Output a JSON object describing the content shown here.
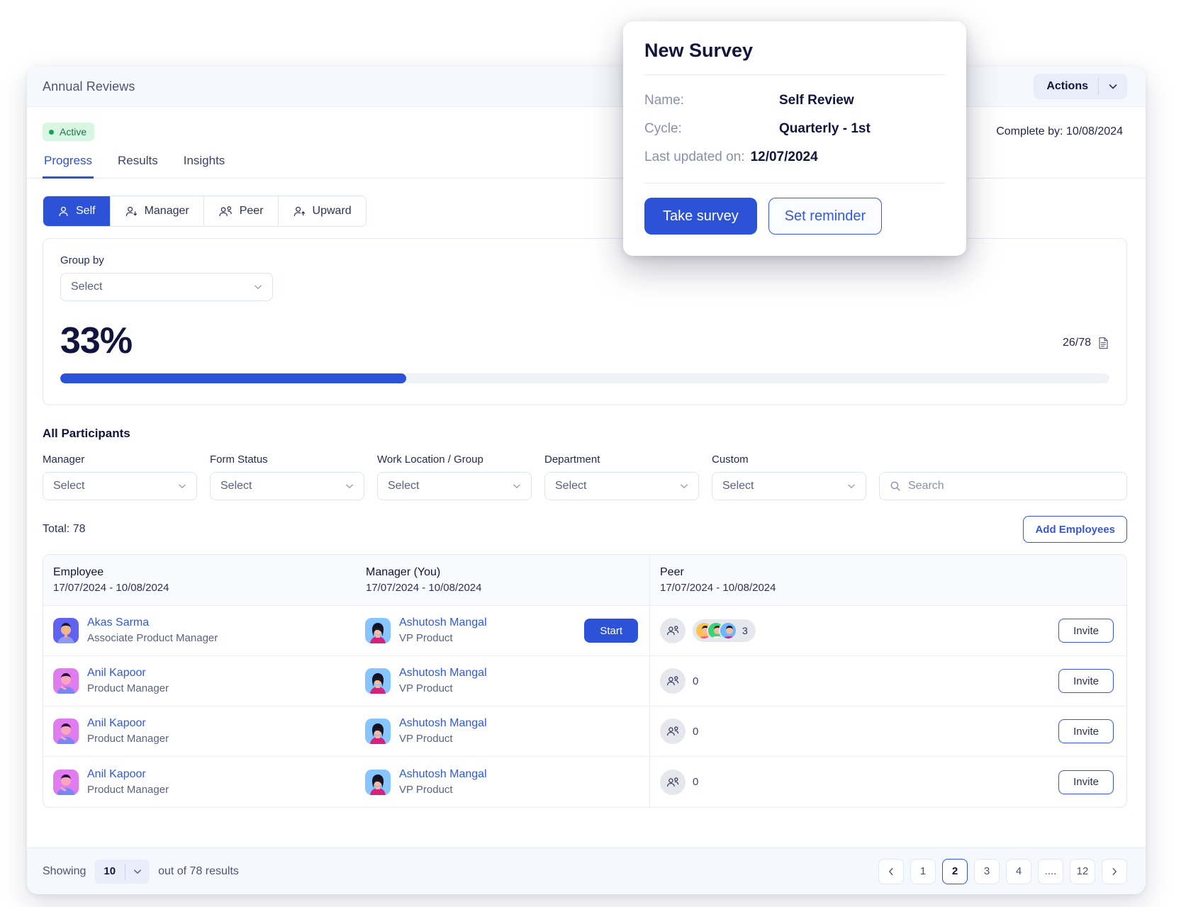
{
  "window": {
    "title": "Annual Reviews",
    "actions_label": "Actions",
    "status_badge": "Active",
    "complete_by": "Complete by: 10/08/2024"
  },
  "tabs": [
    {
      "label": "Progress",
      "active": true
    },
    {
      "label": "Results",
      "active": false
    },
    {
      "label": "Insights",
      "active": false
    }
  ],
  "segments": [
    {
      "label": "Self",
      "icon": "person-icon",
      "active": true
    },
    {
      "label": "Manager",
      "icon": "person-down-icon",
      "active": false
    },
    {
      "label": "Peer",
      "icon": "people-icon",
      "active": false
    },
    {
      "label": "Upward",
      "icon": "person-up-icon",
      "active": false
    }
  ],
  "progress": {
    "group_by_label": "Group by",
    "group_by_value": "Select",
    "percent_label": "33%",
    "percent_value": 33,
    "counter": "26/78",
    "counter_icon": "document-icon"
  },
  "participants": {
    "section_title": "All Participants",
    "total_label": "Total: 78",
    "add_employees_label": "Add Employees",
    "search_placeholder": "Search",
    "search_value": "",
    "filters": [
      {
        "label": "Manager",
        "value": "Select"
      },
      {
        "label": "Form Status",
        "value": "Select"
      },
      {
        "label": "Work Location / Group",
        "value": "Select"
      },
      {
        "label": "Department",
        "value": "Select"
      },
      {
        "label": "Custom",
        "value": "Select"
      }
    ]
  },
  "table": {
    "headers": [
      {
        "title": "Employee",
        "dates": "17/07/2024 - 10/08/2024"
      },
      {
        "title": "Manager (You)",
        "dates": "17/07/2024 - 10/08/2024"
      },
      {
        "title": "Peer",
        "dates": "17/07/2024 - 10/08/2024"
      }
    ],
    "rows": [
      {
        "employee_name": "Akas Sarma",
        "employee_role": "Associate Product Manager",
        "manager_name": "Ashutosh Mangal",
        "manager_role": "VP Product",
        "action_label": "Start",
        "has_action": true,
        "peer_count": "3",
        "peer_has_avatars": true,
        "invite_label": "Invite"
      },
      {
        "employee_name": "Anil Kapoor",
        "employee_role": "Product Manager",
        "manager_name": "Ashutosh Mangal",
        "manager_role": "VP Product",
        "action_label": "",
        "has_action": false,
        "peer_count": "0",
        "peer_has_avatars": false,
        "invite_label": "Invite"
      },
      {
        "employee_name": "Anil Kapoor",
        "employee_role": "Product Manager",
        "manager_name": "Ashutosh Mangal",
        "manager_role": "VP Product",
        "action_label": "",
        "has_action": false,
        "peer_count": "0",
        "peer_has_avatars": false,
        "invite_label": "Invite"
      },
      {
        "employee_name": "Anil Kapoor",
        "employee_role": "Product Manager",
        "manager_name": "Ashutosh Mangal",
        "manager_role": "VP Product",
        "action_label": "",
        "has_action": false,
        "peer_count": "0",
        "peer_has_avatars": false,
        "invite_label": "Invite"
      }
    ]
  },
  "footer": {
    "showing_label": "Showing",
    "page_size": "10",
    "out_of_label": "out of 78 results",
    "pages": [
      "1",
      "2",
      "3",
      "4",
      "....",
      "12"
    ],
    "active_page": "2",
    "prev_icon": "chevron-left-icon",
    "next_icon": "chevron-right-icon"
  },
  "popover": {
    "title": "New Survey",
    "rows": [
      {
        "key": "Name:",
        "value": "Self Review"
      },
      {
        "key": "Cycle:",
        "value": "Quarterly - 1st"
      },
      {
        "key": "Last updated on:",
        "value": "12/07/2024"
      }
    ],
    "primary_label": "Take survey",
    "secondary_label": "Set reminder"
  },
  "colors": {
    "accent": "#2c52d8",
    "link": "#2f58e0",
    "ink": "#11143c",
    "muted": "#5c6280",
    "active_badge_bg": "#d9f5e3",
    "active_badge_fg": "#177a45"
  }
}
